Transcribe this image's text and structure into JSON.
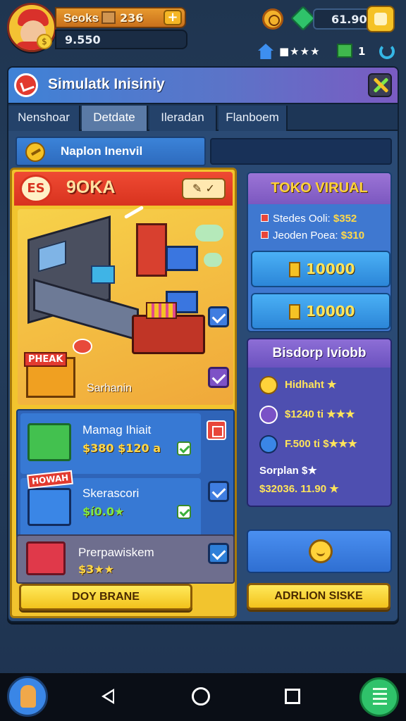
{
  "hud": {
    "player_name": "Seoks",
    "level": "236",
    "money": "9.550",
    "gems": "61.90",
    "stats_text": "■★★★",
    "boxes_count": "1"
  },
  "panel": {
    "title": "Simulatk Inisiniy",
    "tabs": [
      "Nenshoar",
      "Detdate",
      "Ileradan",
      "Flanboem"
    ],
    "active_tab_index": 1,
    "sub_header": "Naplon Inenvil"
  },
  "store": {
    "badge": "ES",
    "name": "9OKA",
    "scene_sign": "PHEAK",
    "scene_caption": "Sarhanin",
    "items": [
      {
        "name": "Mamag Ihiait",
        "price": "$380 $120 a"
      },
      {
        "name": "Skerascori",
        "price": "$í0.0★",
        "tag": "HOWAH"
      },
      {
        "name": "Prerpawiskem",
        "price": "$3★★"
      }
    ],
    "bottom_button": "DOY BRANE"
  },
  "market": {
    "title": "TOKO VIRUAL",
    "lines": [
      {
        "label": "Stedes Ooli:",
        "value": "$352"
      },
      {
        "label": "Jeoden Poea:",
        "value": "$310"
      }
    ],
    "buttons": [
      "10000",
      "10000"
    ]
  },
  "achievements": {
    "title": "Bisdorp Iviobb",
    "items": [
      {
        "text": "Hidhaht ★"
      },
      {
        "text": "$1240 ti ★★★"
      },
      {
        "text": "F.500 ti $★★★"
      }
    ],
    "footer_label": "Sorplan $★",
    "footer_value": "$32036. 11.90 ★"
  },
  "right_bottom_button": "ADRLION SISKE",
  "colors": {
    "accent_yellow": "#f2c42e",
    "accent_red": "#e23a2f",
    "panel_blue": "#2a4a74",
    "purple": "#7c58c0"
  }
}
